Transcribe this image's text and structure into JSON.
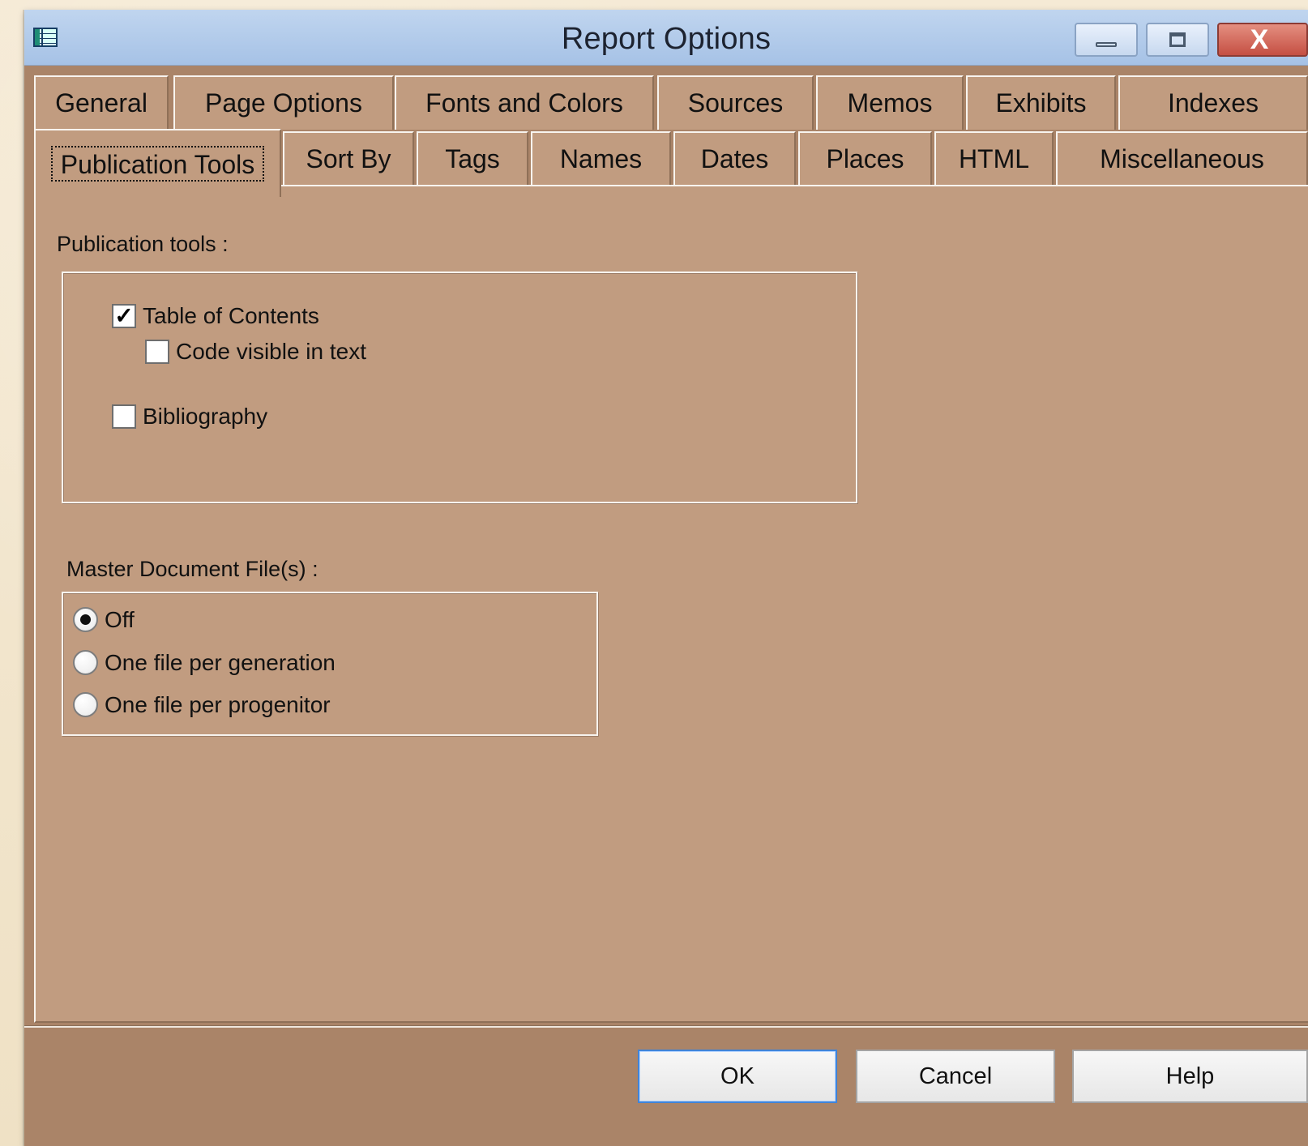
{
  "window": {
    "title": "Report Options",
    "controls": {
      "minimize_icon": "minimize-icon",
      "maximize_icon": "maximize-icon",
      "close_icon": "close-icon",
      "close_text": "X"
    }
  },
  "tabs": {
    "row1": [
      "General",
      "Page Options",
      "Fonts and Colors",
      "Sources",
      "Memos",
      "Exhibits",
      "Indexes"
    ],
    "row2": [
      "Publication Tools",
      "Sort By",
      "Tags",
      "Names",
      "Dates",
      "Places",
      "HTML",
      "Miscellaneous"
    ],
    "active": "Publication Tools"
  },
  "publication_tools": {
    "label": "Publication tools :",
    "table_of_contents": {
      "label": "Table of Contents",
      "checked": true
    },
    "code_visible": {
      "label": "Code visible in text",
      "checked": false
    },
    "bibliography": {
      "label": "Bibliography",
      "checked": false
    }
  },
  "master_document": {
    "label": "Master Document File(s) :",
    "options": [
      {
        "label": "Off",
        "selected": true
      },
      {
        "label": "One file per generation",
        "selected": false
      },
      {
        "label": "One file per progenitor",
        "selected": false
      }
    ]
  },
  "buttons": {
    "ok": "OK",
    "cancel": "Cancel",
    "help": "Help"
  },
  "colors": {
    "titlebar": "#a6c2e6",
    "dialog": "#c19c80",
    "frame": "#aa8468",
    "accent": "#3f84da"
  }
}
